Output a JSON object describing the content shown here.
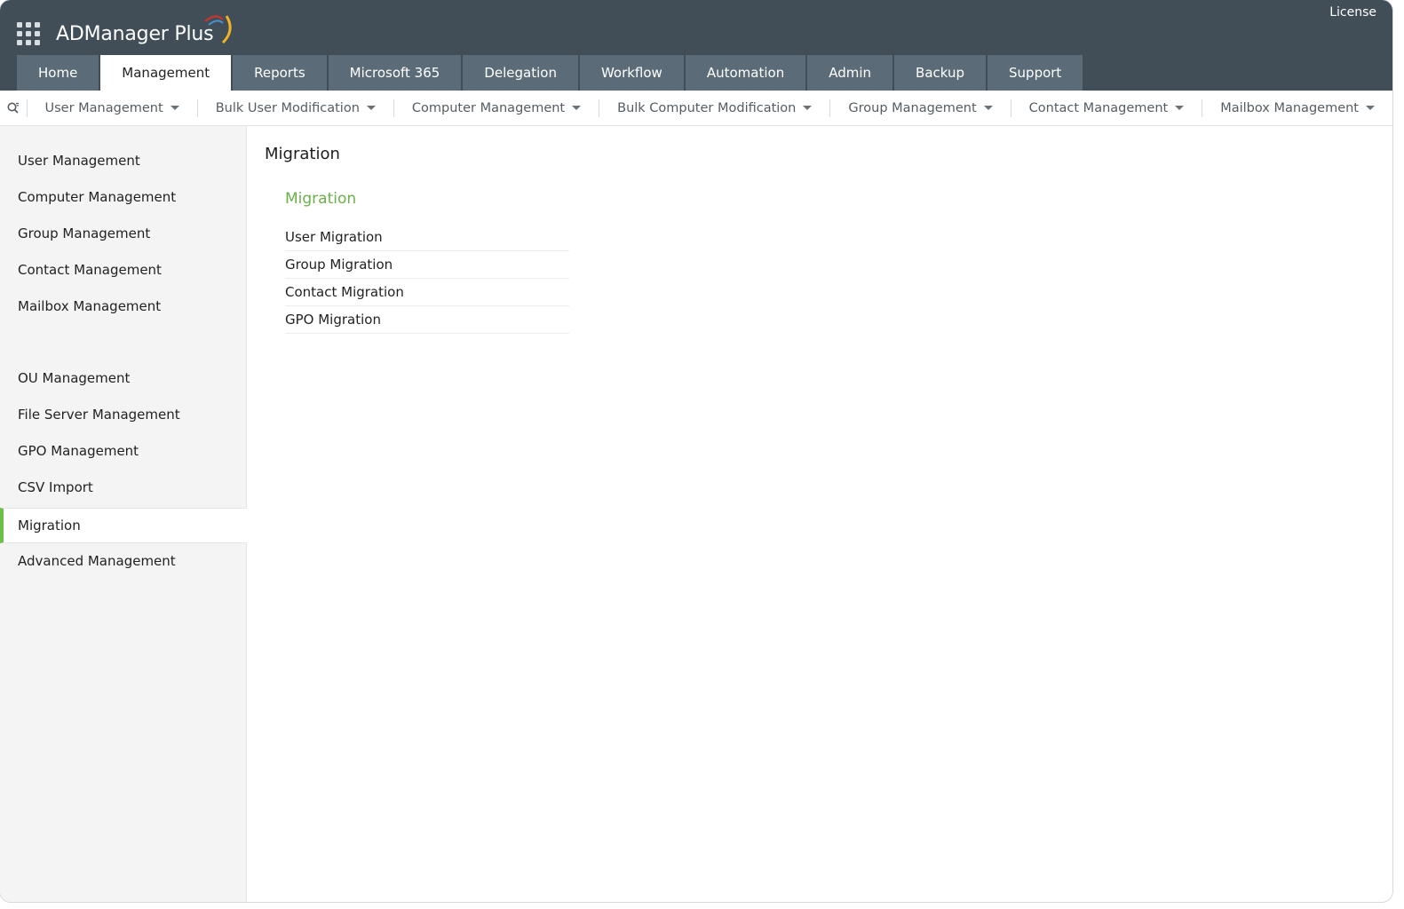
{
  "header": {
    "brand": "ADManager Plus",
    "license_label": "License",
    "tabs": [
      {
        "label": "Home"
      },
      {
        "label": "Management"
      },
      {
        "label": "Reports"
      },
      {
        "label": "Microsoft 365"
      },
      {
        "label": "Delegation"
      },
      {
        "label": "Workflow"
      },
      {
        "label": "Automation"
      },
      {
        "label": "Admin"
      },
      {
        "label": "Backup"
      },
      {
        "label": "Support"
      }
    ],
    "active_tab": "Management"
  },
  "subnav": {
    "items": [
      {
        "label": "User Management"
      },
      {
        "label": "Bulk User Modification"
      },
      {
        "label": "Computer Management"
      },
      {
        "label": "Bulk Computer Modification"
      },
      {
        "label": "Group Management"
      },
      {
        "label": "Contact Management"
      },
      {
        "label": "Mailbox Management"
      }
    ]
  },
  "sidebar": {
    "items": [
      {
        "label": "User Management"
      },
      {
        "label": "Computer Management"
      },
      {
        "label": "Group Management"
      },
      {
        "label": "Contact Management"
      },
      {
        "label": "Mailbox Management"
      },
      {
        "label": "OU Management"
      },
      {
        "label": "File Server Management"
      },
      {
        "label": "GPO Management"
      },
      {
        "label": "CSV Import"
      },
      {
        "label": "Migration"
      },
      {
        "label": "Advanced Management"
      }
    ],
    "active_item": "Migration"
  },
  "main": {
    "page_title": "Migration",
    "section_title": "Migration",
    "links": [
      {
        "label": "User Migration"
      },
      {
        "label": "Group Migration"
      },
      {
        "label": "Contact Migration"
      },
      {
        "label": "GPO Migration"
      }
    ]
  },
  "colors": {
    "header_bg": "#414e58",
    "tab_bg": "#5b6c78",
    "accent_green": "#6cbf4b",
    "sidebar_bg": "#f4f4f4"
  }
}
